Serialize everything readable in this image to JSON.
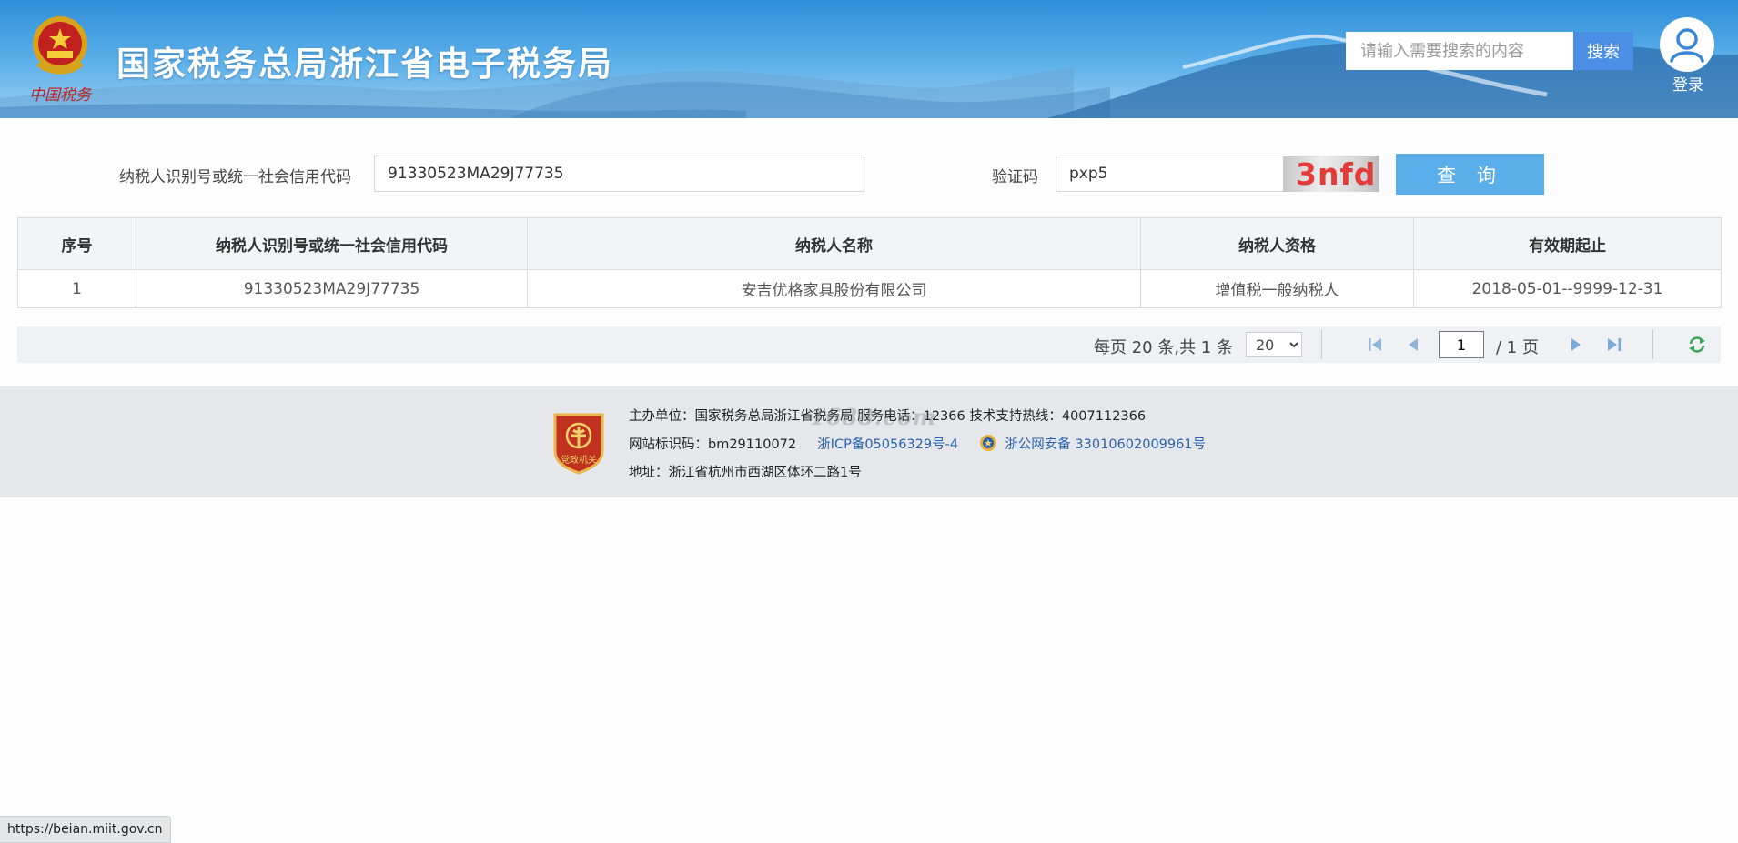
{
  "header": {
    "title": "国家税务总局浙江省电子税务局",
    "emblem_caption": "中国税务",
    "search": {
      "placeholder": "请输入需要搜索的内容",
      "button_label": "搜索"
    },
    "login_label": "登录"
  },
  "query_form": {
    "taxpayer_id_label": "纳税人识别号或统一社会信用代码",
    "taxpayer_id_value": "91330523MA29J77735",
    "captcha_label": "验证码",
    "captcha_value": "pxp5",
    "captcha_image_text": "3nfd",
    "query_button_label": "查 询"
  },
  "table": {
    "columns": [
      "序号",
      "纳税人识别号或统一社会信用代码",
      "纳税人名称",
      "纳税人资格",
      "有效期起止"
    ],
    "rows": [
      [
        "1",
        "91330523MA29J77735",
        "安吉优格家具股份有限公司",
        "增值税一般纳税人",
        "2018-05-01--9999-12-31"
      ]
    ]
  },
  "pager": {
    "summary": "每页 20 条,共 1 条",
    "page_size": "20",
    "current_page": "1",
    "total_pages": "/ 1 页"
  },
  "footer": {
    "organizer": "主办单位：国家税务总局浙江省税务局    服务电话：12366    技术支持热线：4007112366",
    "site_code": "网站标识码：bm29110072",
    "icp": "浙ICP备05056329号-4",
    "police": "浙公网安备 33010602009961号",
    "address": "地址：浙江省杭州市西湖区体环二路1号",
    "badge_text": "党政机关",
    "watermark": "1688.com"
  },
  "status_bar_url": "https://beian.miit.gov.cn",
  "colors": {
    "header_blue": "#2e8fd9",
    "search_button": "#4a8ee6",
    "query_button": "#5aaeea",
    "captcha_text": "#e33a3a",
    "link_blue": "#2a63b0",
    "refresh_green": "#3aa65a"
  }
}
